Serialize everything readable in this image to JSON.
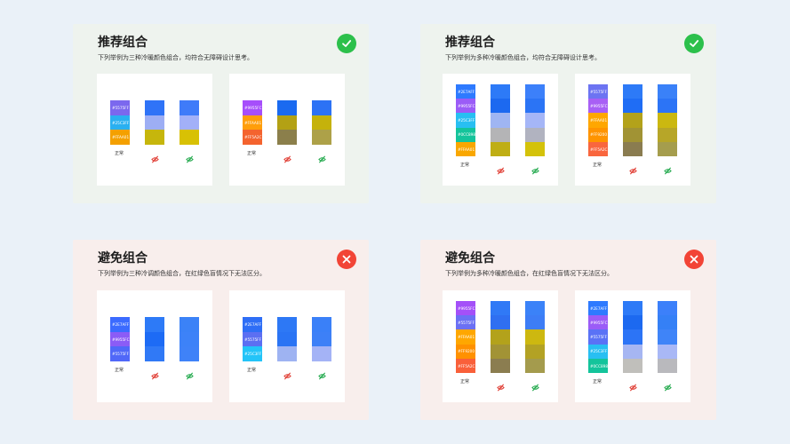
{
  "panels": [
    {
      "title": "推荐组合",
      "subtitle": "下列举例为三种冷暖颜色组合，均符合无障碍设计思考。",
      "status": "check",
      "cards": [
        {
          "columns": [
            [
              "#5575FF|#7B68EE",
              "#25C3FF|#2AB0F0",
              "#FFAA01|#F4A000"
            ],
            [
              "#2F73F7",
              "#9DAEF4",
              "#C6B60C"
            ],
            [
              "#3F7BF9",
              "#A2B0F8",
              "#D8C104"
            ]
          ],
          "captions": [
            "正常",
            "x",
            "ok"
          ]
        },
        {
          "columns": [
            [
              "#9955FC|#A64EFB",
              "#FFAA01|#FF9E0A",
              "#FF5A2C|#F4632E"
            ],
            [
              "#1A6AF0",
              "#B3A114",
              "#8B7F4B"
            ],
            [
              "#2C72F5",
              "#C5B20B",
              "#ADA148"
            ]
          ],
          "captions": [
            "正常",
            "x",
            "ok"
          ]
        }
      ]
    },
    {
      "title": "推荐组合",
      "subtitle": "下列举例为多种冷暖颜色组合，均符合无障碍设计思考。",
      "status": "check",
      "cards": [
        {
          "columns": [
            [
              "#2E7AFF|#2E7AFF",
              "#9955FC|#9B5CF7",
              "#25C3FF|#28BFF2",
              "#0CC898|#14C49B",
              "#FFAA01|#F9A700"
            ],
            [
              "#2D7AF7",
              "#1C69F0",
              "#9FB5F2",
              "#B4B4B6",
              "#BFAE14"
            ],
            [
              "#3C80FA",
              "#2B74F5",
              "#A5B6F7",
              "#B1B3C0",
              "#D4C20A"
            ]
          ],
          "captions": [
            "正常",
            "x",
            "ok"
          ]
        },
        {
          "columns": [
            [
              "#5575FF|#6D74F2",
              "#9955FC|#A85FF5",
              "#FFAA01|#FFA700",
              "#FF9200|#FF9400",
              "#FF5A2C|#F9663E"
            ],
            [
              "#2D7AF7",
              "#1F6DF5",
              "#B3A21A",
              "#A19334",
              "#8A7C50"
            ],
            [
              "#3A81F8",
              "#2C74F6",
              "#CBB810",
              "#B7A628",
              "#A59D4D"
            ]
          ],
          "captions": [
            "正常",
            "x",
            "ok"
          ]
        }
      ]
    },
    {
      "title": "避免组合",
      "subtitle": "下列举例为三种冷调颜色组合，在红绿色盲情况下无法区分。",
      "status": "cross",
      "cards": [
        {
          "columns": [
            [
              "#2E7AFF|#3B6BFF",
              "#9955FC|#8B5CF6",
              "#5575FF|#5068F8"
            ],
            [
              "#2D7AF7",
              "#1D6BF5",
              "#3079F6"
            ],
            [
              "#3B82F7",
              "#3D82F8",
              "#3F82F8"
            ]
          ],
          "captions": [
            "正常",
            "x",
            "ok"
          ]
        },
        {
          "columns": [
            [
              "#2E7AFF|#2E6EF6",
              "#5575FF|#5C6FF2",
              "#25C3FF|#23C4F8"
            ],
            [
              "#2D78F5",
              "#2A74F4",
              "#9EB3F2"
            ],
            [
              "#3A80F8",
              "#3D80F7",
              "#A4B3F6"
            ]
          ],
          "captions": [
            "正常",
            "x",
            "ok"
          ]
        }
      ]
    },
    {
      "title": "避免组合",
      "subtitle": "下列举例为多种冷暖颜色组合，在红绿色盲情况下无法区分。",
      "status": "cross",
      "cards": [
        {
          "columns": [
            [
              "#9955FC|#A450F8",
              "#5575FF|#6B70F4",
              "#FFAA01|#FFA700",
              "#FF9200|#FF9100",
              "#FF5A2C|#F9603A"
            ],
            [
              "#3079F6",
              "#2F6FF1",
              "#B3A21B",
              "#A29335",
              "#8B7D50"
            ],
            [
              "#3B82F8",
              "#3D7DF6",
              "#CDB810",
              "#B3A224",
              "#A49B4D"
            ]
          ],
          "captions": [
            "正常",
            "x",
            "ok"
          ]
        },
        {
          "columns": [
            [
              "#2E7AFF|#2E7AFF",
              "#9955FC|#9B5CF7",
              "#5575FF|#5A72F6",
              "#25C3FF|#28BFF2",
              "#0CC898|#14C49B"
            ],
            [
              "#2D7AF7",
              "#1C69F0",
              "#2C74F6",
              "#A6B6F2",
              "#C0BFBB"
            ],
            [
              "#3C80FA",
              "#3580F6",
              "#3F84F8",
              "#A9B8F6",
              "#B9B9BD"
            ]
          ],
          "captions": [
            "正常",
            "x",
            "ok"
          ]
        }
      ]
    }
  ],
  "colors": {
    "recommend_bg": "#eef3ee",
    "avoid_bg": "#f8eeec",
    "check": "#2cc04b",
    "cross": "#f24436",
    "page_bg": "#eaf1f8"
  }
}
